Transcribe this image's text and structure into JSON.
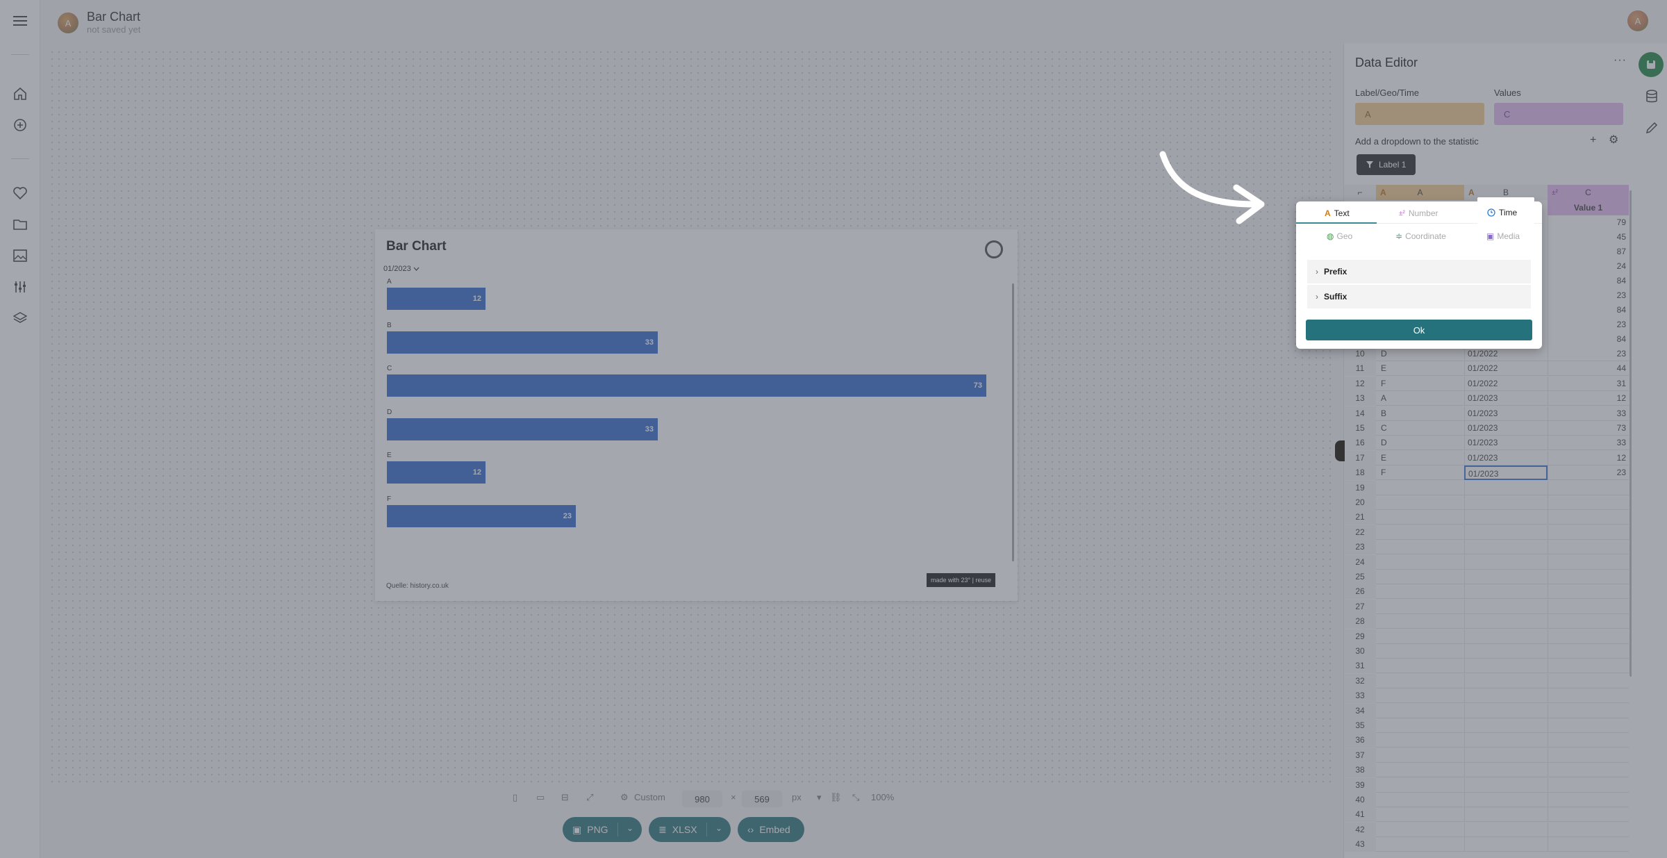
{
  "app": {
    "title": "Bar Chart",
    "subtitle": "not saved yet",
    "avatar_initial": "A"
  },
  "sidebar": {
    "icons": [
      "menu-icon",
      "home-icon",
      "plus-circle-icon",
      "heart-icon",
      "folder-icon",
      "image-icon",
      "sliders-icon",
      "layers-icon"
    ]
  },
  "chart": {
    "title": "Bar Chart",
    "dropdown_value": "01/2023",
    "source": "Quelle: history.co.uk",
    "made_with": "made with 23° | reuse"
  },
  "chart_data": {
    "type": "bar",
    "orientation": "horizontal",
    "title": "Bar Chart",
    "categories": [
      "A",
      "B",
      "C",
      "D",
      "E",
      "F"
    ],
    "values": [
      12,
      33,
      73,
      33,
      12,
      23
    ],
    "xlim": [
      0,
      73
    ],
    "color": "#2660cc"
  },
  "bottom": {
    "preset_label": "Custom",
    "width": "980",
    "times": "×",
    "height": "569",
    "unit": "px",
    "zoom": "100%",
    "export_png": "PNG",
    "export_xlsx": "XLSX",
    "embed": "Embed"
  },
  "editor": {
    "title": "Data Editor",
    "menu": "···",
    "label_geo_time_label": "Label/Geo/Time",
    "label_geo_time_value": "A",
    "values_label": "Values",
    "values_value": "C",
    "add_dropdown": "Add a dropdown to the statistic",
    "plus": "+",
    "label_button": "Label 1",
    "columns": {
      "a_type": "A",
      "a_name": "A",
      "b_type": "A",
      "b_name": "B",
      "c_type": "±²",
      "c_name": "C",
      "c_sub": "Value 1"
    },
    "top_values": [
      "79",
      "45",
      "87",
      "24",
      "84",
      "23",
      "84",
      "23",
      "84"
    ],
    "rows": [
      {
        "n": "10",
        "a": "D",
        "b": "01/2022",
        "c": "23"
      },
      {
        "n": "11",
        "a": "E",
        "b": "01/2022",
        "c": "44"
      },
      {
        "n": "12",
        "a": "F",
        "b": "01/2022",
        "c": "31"
      },
      {
        "n": "13",
        "a": "A",
        "b": "01/2023",
        "c": "12"
      },
      {
        "n": "14",
        "a": "B",
        "b": "01/2023",
        "c": "33"
      },
      {
        "n": "15",
        "a": "C",
        "b": "01/2023",
        "c": "73"
      },
      {
        "n": "16",
        "a": "D",
        "b": "01/2023",
        "c": "33"
      },
      {
        "n": "17",
        "a": "E",
        "b": "01/2023",
        "c": "12"
      },
      {
        "n": "18",
        "a": "F",
        "b": "01/2023",
        "c": "23"
      },
      {
        "n": "19",
        "a": "",
        "b": "",
        "c": ""
      },
      {
        "n": "20",
        "a": "",
        "b": "",
        "c": ""
      },
      {
        "n": "21",
        "a": "",
        "b": "",
        "c": ""
      },
      {
        "n": "22",
        "a": "",
        "b": "",
        "c": ""
      },
      {
        "n": "23",
        "a": "",
        "b": "",
        "c": ""
      },
      {
        "n": "24",
        "a": "",
        "b": "",
        "c": ""
      },
      {
        "n": "25",
        "a": "",
        "b": "",
        "c": ""
      },
      {
        "n": "26",
        "a": "",
        "b": "",
        "c": ""
      },
      {
        "n": "27",
        "a": "",
        "b": "",
        "c": ""
      },
      {
        "n": "28",
        "a": "",
        "b": "",
        "c": ""
      },
      {
        "n": "29",
        "a": "",
        "b": "",
        "c": ""
      },
      {
        "n": "30",
        "a": "",
        "b": "",
        "c": ""
      },
      {
        "n": "31",
        "a": "",
        "b": "",
        "c": ""
      },
      {
        "n": "32",
        "a": "",
        "b": "",
        "c": ""
      },
      {
        "n": "33",
        "a": "",
        "b": "",
        "c": ""
      },
      {
        "n": "34",
        "a": "",
        "b": "",
        "c": ""
      },
      {
        "n": "35",
        "a": "",
        "b": "",
        "c": ""
      },
      {
        "n": "36",
        "a": "",
        "b": "",
        "c": ""
      },
      {
        "n": "37",
        "a": "",
        "b": "",
        "c": ""
      },
      {
        "n": "38",
        "a": "",
        "b": "",
        "c": ""
      },
      {
        "n": "39",
        "a": "",
        "b": "",
        "c": ""
      },
      {
        "n": "40",
        "a": "",
        "b": "",
        "c": ""
      },
      {
        "n": "41",
        "a": "",
        "b": "",
        "c": ""
      },
      {
        "n": "42",
        "a": "",
        "b": "",
        "c": ""
      },
      {
        "n": "43",
        "a": "",
        "b": "",
        "c": ""
      }
    ]
  },
  "popup": {
    "tab_text": "Text",
    "tab_number": "Number",
    "tab_time": "Time",
    "tab_geo": "Geo",
    "tab_coordinate": "Coordinate",
    "tab_media": "Media",
    "prefix": "Prefix",
    "suffix": "Suffix",
    "ok": "Ok"
  },
  "colors": {
    "accent": "#26727c",
    "bar": "#2660cc",
    "save": "#12803a",
    "label_col": "#f5c98a",
    "value_col": "#e3b6f0"
  }
}
